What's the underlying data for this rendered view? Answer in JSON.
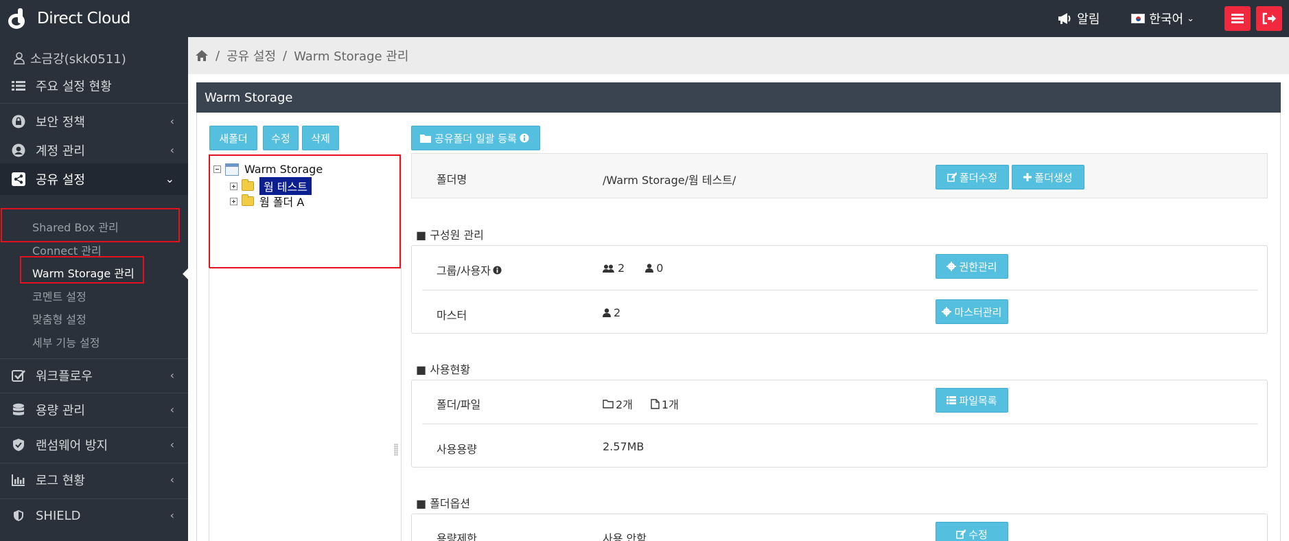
{
  "app": {
    "logo_text": "Direct Cloud"
  },
  "topbar": {
    "notify_label": "알림",
    "lang_label": "한국어",
    "colors": {
      "bar": "#2b313a",
      "action_red": "#f0293e"
    }
  },
  "sidebar": {
    "user": "소금강(skk0511)",
    "items": [
      {
        "label": "주요 설정 현황",
        "icon": "list-icon"
      },
      {
        "label": "보안 정책",
        "icon": "lock-icon"
      },
      {
        "label": "계정 관리",
        "icon": "user-circle-icon"
      },
      {
        "label": "공유 설정",
        "icon": "share-icon"
      },
      {
        "label": "워크플로우",
        "icon": "checkbox-icon"
      },
      {
        "label": "용량 관리",
        "icon": "database-icon"
      },
      {
        "label": "랜섬웨어 방지",
        "icon": "shield-check-icon"
      },
      {
        "label": "로그 현황",
        "icon": "bar-chart-icon"
      },
      {
        "label": "SHIELD",
        "icon": "shield-icon"
      }
    ],
    "sub_items": [
      {
        "label": "Shared Box 관리"
      },
      {
        "label": "Connect 관리"
      },
      {
        "label": "Warm Storage 관리"
      },
      {
        "label": "코멘트 설정"
      },
      {
        "label": "맞춤형 설정"
      },
      {
        "label": "세부 기능 설정"
      }
    ]
  },
  "breadcrumb": {
    "level1": "공유 설정",
    "level2": "Warm Storage 관리",
    "separator": "/"
  },
  "panel": {
    "title": "Warm Storage"
  },
  "tree_toolbar": {
    "new_folder": "새폴더",
    "edit": "수정",
    "delete": "삭제"
  },
  "tree": {
    "root": "Warm Storage",
    "children": [
      {
        "label": "웜 테스트",
        "selected": true
      },
      {
        "label": "웜 폴더 A",
        "selected": false
      }
    ]
  },
  "bulk_register": {
    "label": "공유폴더 일괄 등록"
  },
  "folder_info": {
    "name_label": "폴더명",
    "path": "/Warm Storage/웜 테스트/",
    "edit_button": "폴더수정",
    "create_button": "폴더생성"
  },
  "members": {
    "section_title": "■ 구성원 관리",
    "group_user_label": "그룹/사용자",
    "group_count": "2",
    "user_count": "0",
    "permission_button": "권한관리",
    "master_label": "마스터",
    "master_count": "2",
    "master_button": "마스터관리"
  },
  "usage": {
    "section_title": "■ 사용현황",
    "folder_file_label": "폴더/파일",
    "folder_count": "2개",
    "file_count": "1개",
    "file_list_button": "파일목록",
    "capacity_label": "사용용량",
    "capacity_value": "2.57MB"
  },
  "options": {
    "section_title": "■ 폴더옵션",
    "limit_label": "용량제한",
    "limit_value": "사용 안함",
    "edit_button": "수정"
  }
}
